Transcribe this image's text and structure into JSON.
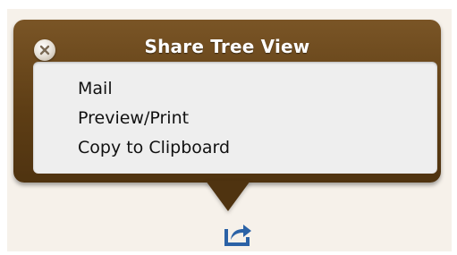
{
  "popover": {
    "title": "Share Tree View",
    "close_icon": "close-x-icon",
    "items": [
      {
        "label": "Mail"
      },
      {
        "label": "Preview/Print"
      },
      {
        "label": "Copy to Clipboard"
      }
    ]
  },
  "share_button": {
    "icon": "share-arrow-icon"
  },
  "colors": {
    "popover_brown": "#5e3e15",
    "menu_background": "#eeeeee",
    "share_icon_blue": "#2b62a6",
    "page_background": "#f6f1ea"
  }
}
